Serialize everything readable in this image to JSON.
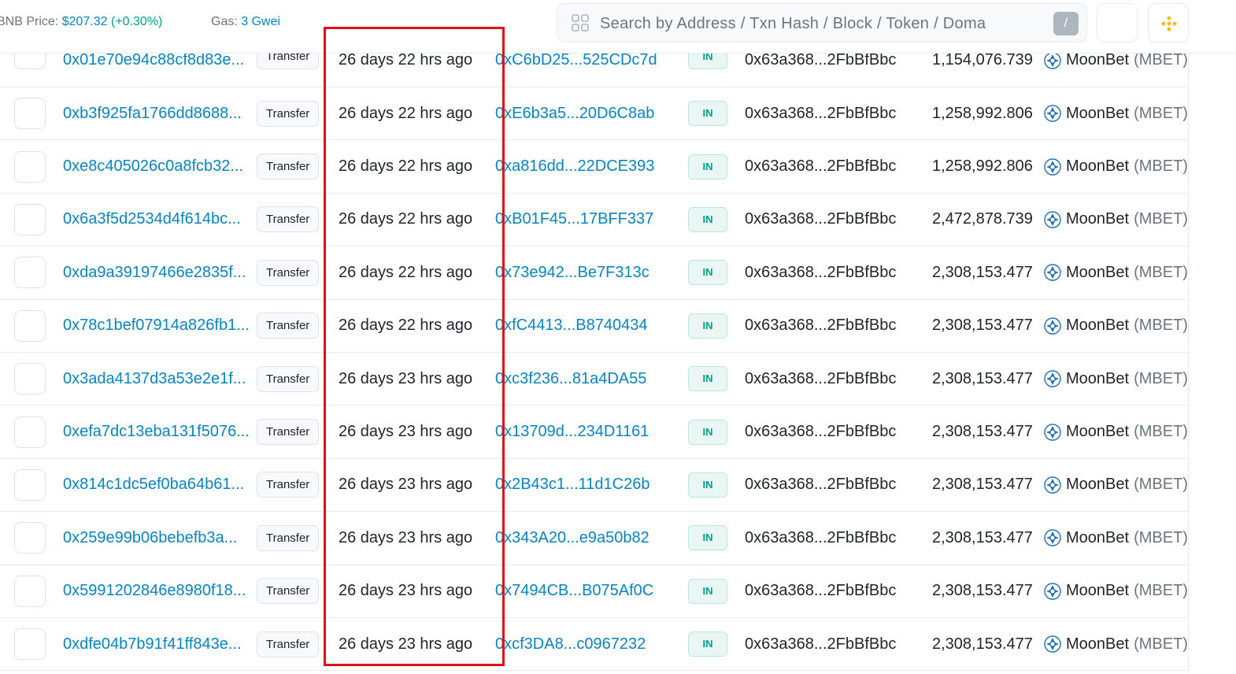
{
  "header": {
    "price_label": "BNB Price:",
    "price_value": "$207.32",
    "price_change": "(+0.30%)",
    "gas_label": "Gas:",
    "gas_value": "3 Gwei",
    "search_placeholder": "Search by Address / Txn Hash / Block / Token / Doma",
    "slash_key": "/"
  },
  "rows": [
    {
      "hash": "0x01e70e94c88cf8d83e...",
      "method": "Transfer",
      "age": "26 days 22 hrs ago",
      "from": "0xC6bD25...525CDc7d",
      "dir": "IN",
      "to": "0x63a368...2FbBfBbc",
      "qty": "1,154,076.739",
      "token": "MoonBet",
      "symbol": "(MBET)"
    },
    {
      "hash": "0xb3f925fa1766dd8688...",
      "method": "Transfer",
      "age": "26 days 22 hrs ago",
      "from": "0xE6b3a5...20D6C8ab",
      "dir": "IN",
      "to": "0x63a368...2FbBfBbc",
      "qty": "1,258,992.806",
      "token": "MoonBet",
      "symbol": "(MBET)"
    },
    {
      "hash": "0xe8c405026c0a8fcb32...",
      "method": "Transfer",
      "age": "26 days 22 hrs ago",
      "from": "0xa816dd...22DCE393",
      "dir": "IN",
      "to": "0x63a368...2FbBfBbc",
      "qty": "1,258,992.806",
      "token": "MoonBet",
      "symbol": "(MBET)"
    },
    {
      "hash": "0x6a3f5d2534d4f614bc...",
      "method": "Transfer",
      "age": "26 days 22 hrs ago",
      "from": "0xB01F45...17BFF337",
      "dir": "IN",
      "to": "0x63a368...2FbBfBbc",
      "qty": "2,472,878.739",
      "token": "MoonBet",
      "symbol": "(MBET)"
    },
    {
      "hash": "0xda9a39197466e2835f...",
      "method": "Transfer",
      "age": "26 days 22 hrs ago",
      "from": "0x73e942...Be7F313c",
      "dir": "IN",
      "to": "0x63a368...2FbBfBbc",
      "qty": "2,308,153.477",
      "token": "MoonBet",
      "symbol": "(MBET)"
    },
    {
      "hash": "0x78c1bef07914a826fb1...",
      "method": "Transfer",
      "age": "26 days 22 hrs ago",
      "from": "0xfC4413...B8740434",
      "dir": "IN",
      "to": "0x63a368...2FbBfBbc",
      "qty": "2,308,153.477",
      "token": "MoonBet",
      "symbol": "(MBET)"
    },
    {
      "hash": "0x3ada4137d3a53e2e1f...",
      "method": "Transfer",
      "age": "26 days 23 hrs ago",
      "from": "0xc3f236...81a4DA55",
      "dir": "IN",
      "to": "0x63a368...2FbBfBbc",
      "qty": "2,308,153.477",
      "token": "MoonBet",
      "symbol": "(MBET)"
    },
    {
      "hash": "0xefa7dc13eba131f5076...",
      "method": "Transfer",
      "age": "26 days 23 hrs ago",
      "from": "0x13709d...234D1161",
      "dir": "IN",
      "to": "0x63a368...2FbBfBbc",
      "qty": "2,308,153.477",
      "token": "MoonBet",
      "symbol": "(MBET)"
    },
    {
      "hash": "0x814c1dc5ef0ba64b61...",
      "method": "Transfer",
      "age": "26 days 23 hrs ago",
      "from": "0x2B43c1...11d1C26b",
      "dir": "IN",
      "to": "0x63a368...2FbBfBbc",
      "qty": "2,308,153.477",
      "token": "MoonBet",
      "symbol": "(MBET)"
    },
    {
      "hash": "0x259e99b06bebefb3a...",
      "method": "Transfer",
      "age": "26 days 23 hrs ago",
      "from": "0x343A20...e9a50b82",
      "dir": "IN",
      "to": "0x63a368...2FbBfBbc",
      "qty": "2,308,153.477",
      "token": "MoonBet",
      "symbol": "(MBET)"
    },
    {
      "hash": "0x5991202846e8980f18...",
      "method": "Transfer",
      "age": "26 days 23 hrs ago",
      "from": "0x7494CB...B075Af0C",
      "dir": "IN",
      "to": "0x63a368...2FbBfBbc",
      "qty": "2,308,153.477",
      "token": "MoonBet",
      "symbol": "(MBET)"
    },
    {
      "hash": "0xdfe04b7b91f41ff843e...",
      "method": "Transfer",
      "age": "26 days 23 hrs ago",
      "from": "0xcf3DA8...c0967232",
      "dir": "IN",
      "to": "0x63a368...2FbBfBbc",
      "qty": "2,308,153.477",
      "token": "MoonBet",
      "symbol": "(MBET)"
    }
  ],
  "colors": {
    "link": "#0784c3",
    "in_badge": "#00a186",
    "highlight": "#e3101a"
  }
}
